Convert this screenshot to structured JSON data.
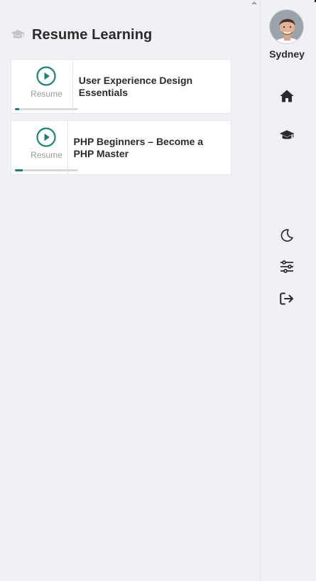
{
  "header": {
    "title": "Resume Learning",
    "icon": "graduation-cap-icon"
  },
  "courses": [
    {
      "title": "User Experience Design Essentials",
      "action_label": "Resume",
      "progress_percent": 7
    },
    {
      "title": "PHP Beginners – Become a PHP Master",
      "action_label": "Resume",
      "progress_percent": 12
    }
  ],
  "user": {
    "name": "Sydney"
  },
  "sidebar_icons": [
    "home-icon",
    "graduation-cap-icon",
    "moon-icon",
    "sliders-icon",
    "logout-icon"
  ],
  "colors": {
    "accent": "#1a8377",
    "background": "#f0f1f5",
    "card": "#ffffff",
    "text": "#2b2b2b"
  }
}
